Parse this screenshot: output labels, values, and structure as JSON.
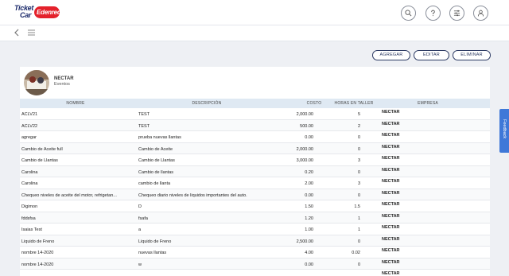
{
  "brand": {
    "line1": "Ticket",
    "line2": "Car",
    "badge": "Edenred",
    "primary_color": "#1b2a6b",
    "badge_color": "#e4212b"
  },
  "header_icons": [
    "search-icon",
    "help-icon",
    "filters-icon",
    "user-icon"
  ],
  "actions": {
    "add": "AGREGAR",
    "edit": "EDITAR",
    "delete": "ELIMINAR"
  },
  "company": {
    "name": "NECTAR",
    "subtitle": "Eventos"
  },
  "table": {
    "headers": {
      "nombre": "NOMBRE",
      "descripcion": "DESCRIPCIÓN",
      "costo": "COSTO",
      "horas": "HORAS EN TALLER",
      "empresa": "EMPRESA"
    },
    "rows": [
      {
        "nombre": "ACLV21",
        "descripcion": "TEST",
        "costo": "2,000.00",
        "horas": "5",
        "empresa": "NECTAR"
      },
      {
        "nombre": "ACLV22",
        "descripcion": "TEST",
        "costo": "500.00",
        "horas": "2",
        "empresa": "NECTAR"
      },
      {
        "nombre": "agregar",
        "descripcion": "prueba nuevas llantas",
        "costo": "0.00",
        "horas": "0",
        "empresa": "NECTAR"
      },
      {
        "nombre": "Cambio de Aceite full",
        "descripcion": "Cambio de Aceite",
        "costo": "2,000.00",
        "horas": "0",
        "empresa": "NECTAR"
      },
      {
        "nombre": "Cambio de Llantas",
        "descripcion": "Cambio de Llantas",
        "costo": "3,000.00",
        "horas": "3",
        "empresa": "NECTAR"
      },
      {
        "nombre": "Carolina",
        "descripcion": "Cambio de llantas",
        "costo": "0.20",
        "horas": "0",
        "empresa": "NECTAR"
      },
      {
        "nombre": "Carolina",
        "descripcion": "cambio de llanta",
        "costo": "2.00",
        "horas": "3",
        "empresa": "NECTAR"
      },
      {
        "nombre": "Chequeo niveles de aceite del motor, refrigetan...",
        "descripcion": "Chequeo diario niveles de liquidos importantes del auto.",
        "costo": "0.00",
        "horas": "0",
        "empresa": "NECTAR"
      },
      {
        "nombre": "Digimon",
        "descripcion": "D",
        "costo": "1.50",
        "horas": "1.5",
        "empresa": "NECTAR"
      },
      {
        "nombre": "fddsfsa",
        "descripcion": "fsafa",
        "costo": "1.20",
        "horas": "1",
        "empresa": "NECTAR"
      },
      {
        "nombre": "Isaias Test",
        "descripcion": "a",
        "costo": "1.00",
        "horas": "1",
        "empresa": "NECTAR"
      },
      {
        "nombre": "Liquido de Freno",
        "descripcion": "Liquido de Freno",
        "costo": "2,500.00",
        "horas": "0",
        "empresa": "NECTAR"
      },
      {
        "nombre": "nombre 14-2020",
        "descripcion": "nuevas llantas",
        "costo": "4.00",
        "horas": "0.02",
        "empresa": "NECTAR"
      },
      {
        "nombre": "nombre 14-2020",
        "descripcion": "w",
        "costo": "0.00",
        "horas": "0",
        "empresa": "NECTAR"
      },
      {
        "nombre": "",
        "descripcion": "",
        "costo": "",
        "horas": "",
        "empresa": "NECTAR"
      }
    ]
  },
  "feedback": "Feedback",
  "accent_color": "#3f78d8"
}
